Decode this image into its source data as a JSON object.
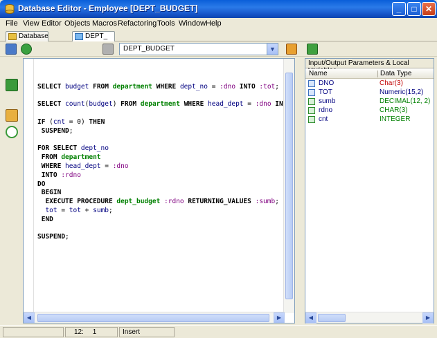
{
  "window": {
    "title": "Database Editor - Employee [DEPT_BUDGET]",
    "minimize": "_",
    "maximize": "□",
    "close": "✕"
  },
  "menu": [
    "File",
    "View",
    "Editor",
    "Objects",
    "Macros",
    "Refactoring",
    "Tools",
    "Window",
    "Help"
  ],
  "tabs": [
    {
      "label": "Database"
    },
    {
      "label": "DEPT_"
    }
  ],
  "toolbar": {
    "procedure_select": "DEPT_BUDGET",
    "dropdown_arrow": "▼"
  },
  "editor": {
    "lines": [
      [],
      [
        {
          "t": "SELECT ",
          "c": "kw"
        },
        {
          "t": "budget ",
          "c": "id"
        },
        {
          "t": "FROM ",
          "c": "kw"
        },
        {
          "t": "department ",
          "c": "tb"
        },
        {
          "t": "WHERE ",
          "c": "kw"
        },
        {
          "t": "dept_no ",
          "c": "id"
        },
        {
          "t": "= ",
          "c": "tx"
        },
        {
          "t": ":dno ",
          "c": "pr"
        },
        {
          "t": "INTO ",
          "c": "kw"
        },
        {
          "t": ":tot",
          "c": "pr"
        },
        {
          "t": ";",
          "c": "tx"
        }
      ],
      [],
      [
        {
          "t": "SELECT ",
          "c": "kw"
        },
        {
          "t": "count",
          "c": "id"
        },
        {
          "t": "(",
          "c": "tx"
        },
        {
          "t": "budget",
          "c": "id"
        },
        {
          "t": ") ",
          "c": "tx"
        },
        {
          "t": "FROM ",
          "c": "kw"
        },
        {
          "t": "department ",
          "c": "tb"
        },
        {
          "t": "WHERE ",
          "c": "kw"
        },
        {
          "t": "head_dept ",
          "c": "id"
        },
        {
          "t": "= ",
          "c": "tx"
        },
        {
          "t": ":dno ",
          "c": "pr"
        },
        {
          "t": "INTO",
          "c": "kw"
        }
      ],
      [],
      [
        {
          "t": "IF ",
          "c": "kw"
        },
        {
          "t": "(",
          "c": "tx"
        },
        {
          "t": "cnt ",
          "c": "id"
        },
        {
          "t": "= 0) ",
          "c": "tx"
        },
        {
          "t": "THEN",
          "c": "kw"
        }
      ],
      [
        {
          "t": " SUSPEND",
          "c": "kw"
        },
        {
          "t": ";",
          "c": "tx"
        }
      ],
      [],
      [
        {
          "t": "FOR SELECT ",
          "c": "kw"
        },
        {
          "t": "dept_no",
          "c": "id"
        }
      ],
      [
        {
          "t": " FROM ",
          "c": "kw"
        },
        {
          "t": "department",
          "c": "tb"
        }
      ],
      [
        {
          "t": " WHERE ",
          "c": "kw"
        },
        {
          "t": "head_dept ",
          "c": "id"
        },
        {
          "t": "= ",
          "c": "tx"
        },
        {
          "t": ":dno",
          "c": "pr"
        }
      ],
      [
        {
          "t": " INTO ",
          "c": "kw"
        },
        {
          "t": ":rdno",
          "c": "pr"
        }
      ],
      [
        {
          "t": "DO",
          "c": "kw"
        }
      ],
      [
        {
          "t": " BEGIN",
          "c": "kw"
        }
      ],
      [
        {
          "t": "  EXECUTE PROCEDURE ",
          "c": "kw"
        },
        {
          "t": "dept_budget ",
          "c": "tb"
        },
        {
          "t": ":rdno ",
          "c": "pr"
        },
        {
          "t": "RETURNING_VALUES ",
          "c": "kw"
        },
        {
          "t": ":sumb",
          "c": "pr"
        },
        {
          "t": ";",
          "c": "tx"
        }
      ],
      [
        {
          "t": "  tot ",
          "c": "id"
        },
        {
          "t": "= ",
          "c": "tx"
        },
        {
          "t": "tot ",
          "c": "id"
        },
        {
          "t": "+ ",
          "c": "tx"
        },
        {
          "t": "sumb",
          "c": "id"
        },
        {
          "t": ";",
          "c": "tx"
        }
      ],
      [
        {
          "t": " END",
          "c": "kw"
        }
      ],
      [],
      [
        {
          "t": "SUSPEND",
          "c": "kw"
        },
        {
          "t": ";",
          "c": "tx"
        }
      ]
    ]
  },
  "params_panel": {
    "title": "Input/Output Parameters & Local Variables",
    "col_name": "Name",
    "col_type": "Data Type",
    "rows": [
      {
        "name": "DNO",
        "type": "Char(3)",
        "type_color": "#c00000"
      },
      {
        "name": "TOT",
        "type": "Numeric(15,2)",
        "type_color": "#000080"
      },
      {
        "name": "sumb",
        "type": "DECIMAL(12, 2)",
        "type_color": "#008000"
      },
      {
        "name": "rdno",
        "type": "CHAR(3)",
        "type_color": "#008000"
      },
      {
        "name": "cnt",
        "type": "INTEGER",
        "type_color": "#008000"
      }
    ]
  },
  "status": {
    "line": "12:",
    "col": "1",
    "mode": "Insert"
  },
  "scroll": {
    "left": "◀",
    "right": "▶",
    "up": "▲",
    "down": "▼"
  }
}
